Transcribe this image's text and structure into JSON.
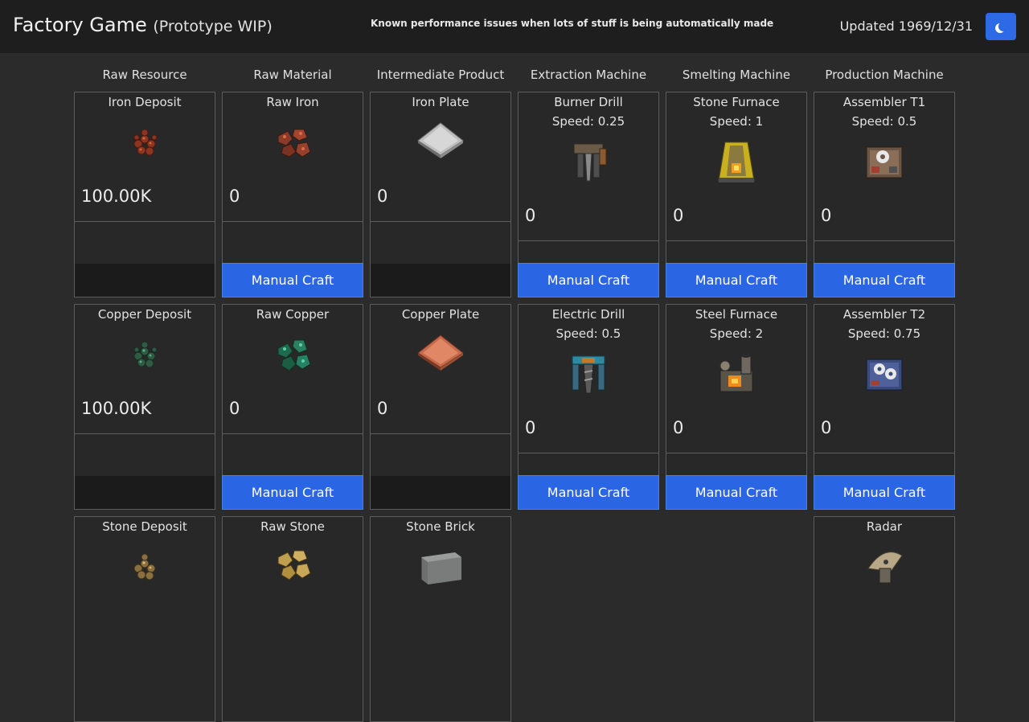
{
  "navbar": {
    "title": "Factory Game",
    "subtitle": "(Prototype WIP)",
    "notice": "Known performance issues when lots of stuff is being automatically made",
    "updated": "Updated 1969/12/31",
    "theme_toggle_icon": "moon-icon"
  },
  "columns": [
    "Raw Resource",
    "Raw Material",
    "Intermediate Product",
    "Extraction Machine",
    "Smelting Machine",
    "Production Machine"
  ],
  "craft_label": "Manual Craft",
  "cards": {
    "iron_deposit": {
      "name": "Iron Deposit",
      "count": "100.00K",
      "icon": "iron-ore-icon"
    },
    "raw_iron": {
      "name": "Raw Iron",
      "count": "0",
      "icon": "raw-iron-icon"
    },
    "iron_plate": {
      "name": "Iron Plate",
      "count": "0",
      "icon": "iron-plate-icon"
    },
    "burner_drill": {
      "name": "Burner Drill",
      "speed": "Speed: 0.25",
      "count": "0",
      "icon": "burner-drill-icon"
    },
    "stone_furnace": {
      "name": "Stone Furnace",
      "speed": "Speed: 1",
      "count": "0",
      "icon": "stone-furnace-icon"
    },
    "assembler_t1": {
      "name": "Assembler T1",
      "speed": "Speed: 0.5",
      "count": "0",
      "icon": "assembler-icon"
    },
    "copper_deposit": {
      "name": "Copper Deposit",
      "count": "100.00K",
      "icon": "copper-ore-icon"
    },
    "raw_copper": {
      "name": "Raw Copper",
      "count": "0",
      "icon": "raw-copper-icon"
    },
    "copper_plate": {
      "name": "Copper Plate",
      "count": "0",
      "icon": "copper-plate-icon"
    },
    "electric_drill": {
      "name": "Electric Drill",
      "speed": "Speed: 0.5",
      "count": "0",
      "icon": "electric-drill-icon"
    },
    "steel_furnace": {
      "name": "Steel Furnace",
      "speed": "Speed: 2",
      "count": "0",
      "icon": "steel-furnace-icon"
    },
    "assembler_t2": {
      "name": "Assembler T2",
      "speed": "Speed: 0.75",
      "count": "0",
      "icon": "assembler-t2-icon"
    },
    "stone_deposit": {
      "name": "Stone Deposit",
      "icon": "stone-ore-icon"
    },
    "raw_stone": {
      "name": "Raw Stone",
      "icon": "raw-stone-icon"
    },
    "stone_brick": {
      "name": "Stone Brick",
      "icon": "stone-brick-icon"
    },
    "radar": {
      "name": "Radar",
      "icon": "radar-icon"
    }
  },
  "colors": {
    "accent": "#2a65e4",
    "background": "#2b2b2b",
    "navbar": "#1e1e1e",
    "card_border": "#5c5c5c"
  }
}
